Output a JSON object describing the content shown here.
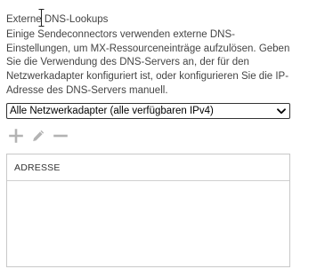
{
  "dns_lookup": {
    "section_title": "Externe DNS-Lookups",
    "description": "Einige Sendeconnectors verwenden externe DNS-Einstellungen, um MX-Ressourceneinträge aufzulösen. Geben Sie die Verwendung des DNS-Servers an, der für den Netzwerkadapter konfiguriert ist, oder konfigurieren Sie die IP-Adresse des DNS-Servers manuell.",
    "adapter_select": {
      "value": "Alle Netzwerkadapter (alle verfügbaren IPv4)"
    },
    "toolbar": {
      "add_icon": "plus-icon",
      "edit_icon": "pencil-icon",
      "remove_icon": "minus-icon",
      "icon_color": "#b3b3b3"
    },
    "address_list": {
      "column_header": "ADRESSE",
      "rows": []
    }
  }
}
